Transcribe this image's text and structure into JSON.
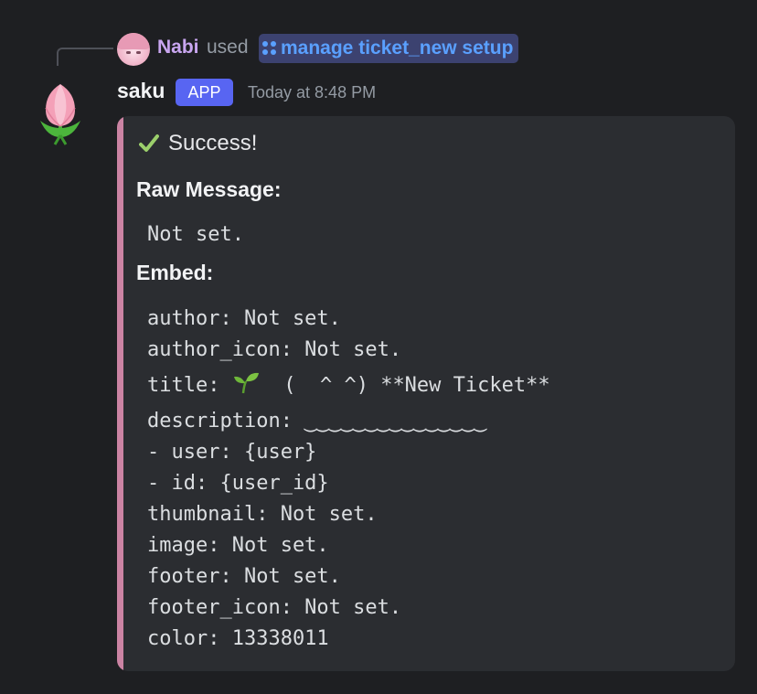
{
  "reply": {
    "user": "Nabi",
    "used_text": "used",
    "command": "manage ticket_new setup"
  },
  "message": {
    "author": "saku",
    "badge": "APP",
    "timestamp": "Today at 8:48 PM"
  },
  "embed": {
    "accent_color": "#cb83a3",
    "status_icon": "check-icon",
    "status": "Success!",
    "raw_label": "Raw Message:",
    "raw_value": "Not set.",
    "embed_label": "Embed:",
    "lines": {
      "author": "author: Not set.",
      "author_icon": "author_icon: Not set.",
      "title_prefix": "title:",
      "title_emoji": "seedling-icon",
      "title_suffix": "(  ^ ^) **New Ticket**",
      "description": "description: ‿‿‿‿‿‿‿‿‿‿‿‿‿‿‿",
      "user": "- user: {user}",
      "id": "- id: {user_id}",
      "thumbnail": "thumbnail: Not set.",
      "image": "image: Not set.",
      "footer": "footer: Not set.",
      "footer_icon": "footer_icon: Not set.",
      "color": "color: 13338011"
    }
  }
}
